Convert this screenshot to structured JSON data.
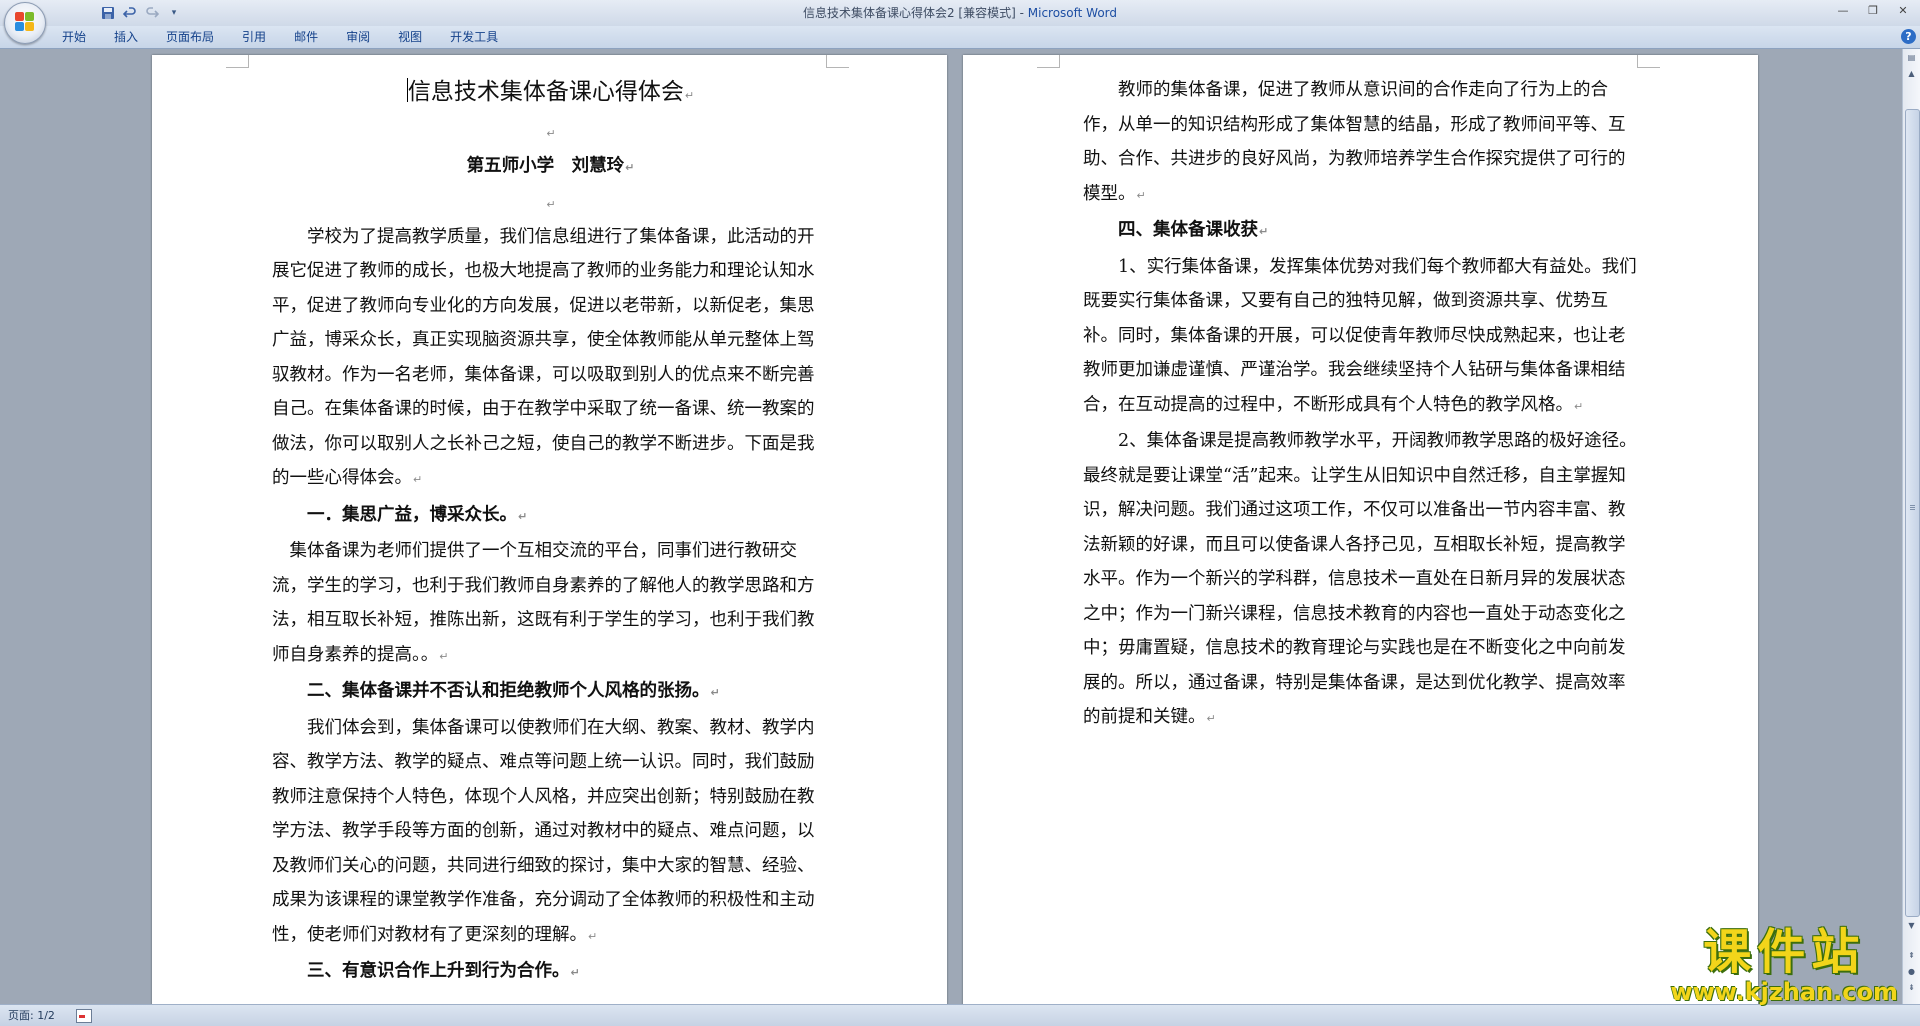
{
  "window": {
    "title": "信息技术集体备课心得体会2 [兼容模式]",
    "title_separator": " - ",
    "app_name": "Microsoft Word"
  },
  "qat": {
    "save_icon": "save-icon",
    "undo_icon": "undo-icon",
    "redo_icon": "redo-icon"
  },
  "ribbon": {
    "tabs": [
      {
        "label": "开始"
      },
      {
        "label": "插入"
      },
      {
        "label": "页面布局"
      },
      {
        "label": "引用"
      },
      {
        "label": "邮件"
      },
      {
        "label": "审阅"
      },
      {
        "label": "视图"
      },
      {
        "label": "开发工具"
      }
    ]
  },
  "document": {
    "page1": {
      "title": "信息技术集体备课心得体会",
      "author": "第五师小学　刘慧玲",
      "intro": "学校为了提高教学质量，我们信息组进行了集体备课，此活动的开展它促进了教师的成长，也极大地提高了教师的业务能力和理论认知水平，促进了教师向专业化的方向发展，促进以老带新，以新促老，集思广益，博采众长，真正实现脑资源共享，使全体教师能从单元整体上驾驭教材。作为一名老师，集体备课，可以吸取到别人的优点来不断完善自己。在集体备课的时候，由于在教学中采取了统一备课、统一教案的做法，你可以取别人之长补己之短，使自己的教学不断进步。下面是我的一些心得体会。",
      "h1": "一．集思广益，博采众长。",
      "p1": "集体备课为老师们提供了一个互相交流的平台，同事们进行教研交流，学生的学习，也利于我们教师自身素养的了解他人的教学思路和方法，相互取长补短，推陈出新，这既有利于学生的学习，也利于我们教师自身素养的提高。。",
      "h2": "二、集体备课并不否认和拒绝教师个人风格的张扬。",
      "p2": "我们体会到，集体备课可以使教师们在大纲、教案、教材、教学内容、教学方法、教学的疑点、难点等问题上统一认识。同时，我们鼓励教师注意保持个人特色，体现个人风格，并应突出创新；特别鼓励在教学方法、教学手段等方面的创新，通过对教材中的疑点、难点问题，以及教师们关心的问题，共同进行细致的探讨，集中大家的智慧、经验、成果为该课程的课堂教学作准备，充分调动了全体教师的积极性和主动性，使老师们对教材有了更深刻的理解。",
      "h3": "三、有意识合作上升到行为合作。"
    },
    "page2": {
      "p1": "教师的集体备课，促进了教师从意识间的合作走向了行为上的合作，从单一的知识结构形成了集体智慧的结晶，形成了教师间平等、互助、合作、共进步的良好风尚，为教师培养学生合作探究提供了可行的模型。",
      "h4": "四、集体备课收获",
      "p2": "1、实行集体备课，发挥集体优势对我们每个教师都大有益处。我们既要实行集体备课，又要有自己的独特见解，做到资源共享、优势互补。同时，集体备课的开展，可以促使青年教师尽快成熟起来，也让老教师更加谦虚谨慎、严谨治学。我会继续坚持个人钻研与集体备课相结合，在互动提高的过程中，不断形成具有个人特色的教学风格。",
      "p3": "2、集体备课是提高教师教学水平，开阔教师教学思路的极好途径。最终就是要让课堂“活”起来。让学生从旧知识中自然迁移，自主掌握知识，解决问题。我们通过这项工作，不仅可以准备出一节内容丰富、教法新颖的好课，而且可以使备课人各抒己见，互相取长补短，提高教学水平。作为一个新兴的学科群，信息技术一直处在日新月异的发展状态之中；作为一门新兴课程，信息技术教育的内容也一直处于动态变化之中；毋庸置疑，信息技术的教育理论与实践也是在不断变化之中向前发展的。所以，通过备课，特别是集体备课，是达到优化教学、提高效率的前提和关键。"
    },
    "paragraph_mark": "↵"
  },
  "statusbar": {
    "page_count": "页面: 1/2"
  },
  "watermark": {
    "big": "课件站",
    "small": "www.kjzhan.com"
  },
  "colors": {
    "app_blue": "#1d4ea3",
    "ribbon_text": "#15428b",
    "watermark_yellow": "#f2d51a",
    "watermark_green": "#3c6e0d"
  }
}
